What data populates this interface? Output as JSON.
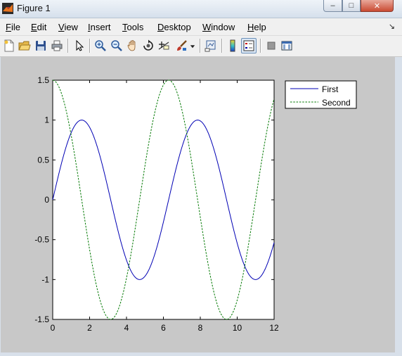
{
  "window": {
    "title": "Figure 1",
    "buttons": {
      "minimize": "–",
      "maximize": "□",
      "close": "✕"
    }
  },
  "menu": {
    "items": [
      {
        "name": "File",
        "key": "F",
        "rest": "ile"
      },
      {
        "name": "Edit",
        "key": "E",
        "rest": "dit"
      },
      {
        "name": "View",
        "key": "V",
        "rest": "iew"
      },
      {
        "name": "Insert",
        "key": "I",
        "rest": "nsert"
      },
      {
        "name": "Tools",
        "key": "T",
        "rest": "ools"
      },
      {
        "name": "Desktop",
        "key": "D",
        "rest": "esktop"
      },
      {
        "name": "Window",
        "key": "W",
        "rest": "indow"
      },
      {
        "name": "Help",
        "key": "H",
        "rest": "elp"
      }
    ],
    "overflow_arrow": "↘"
  },
  "toolbar": {
    "icons": [
      "new-figure-icon",
      "open-file-icon",
      "save-icon",
      "print-icon",
      "edit-plot-icon",
      "zoom-in-icon",
      "zoom-out-icon",
      "pan-icon",
      "rotate-3d-icon",
      "data-cursor-icon",
      "brush-icon",
      "brush-dropdown-icon",
      "link-plot-icon",
      "colorbar-icon",
      "legend-icon",
      "hide-plot-tools-icon",
      "show-plot-tools-icon"
    ]
  },
  "chart_data": {
    "type": "line",
    "title": "",
    "xlabel": "",
    "ylabel": "",
    "xlim": [
      0,
      12
    ],
    "ylim": [
      -1.5,
      1.5
    ],
    "xticks": [
      "0",
      "2",
      "4",
      "6",
      "8",
      "10",
      "12"
    ],
    "yticks": [
      "1.5",
      "1",
      "0.5",
      "0",
      "-0.5",
      "-1",
      "-1.5"
    ],
    "grid": false,
    "legend_position": "outside-top-right",
    "series": [
      {
        "name": "First",
        "function": "sin(x)",
        "color": "#0000b4",
        "style": "solid",
        "x": [
          0,
          1,
          1.571,
          2,
          3,
          4,
          4.712,
          5,
          6,
          7,
          7.854,
          8,
          9,
          10,
          10.996,
          11,
          12
        ],
        "values": [
          0,
          0.841,
          1,
          0.909,
          0.141,
          -0.757,
          -1,
          -0.959,
          -0.279,
          0.657,
          1,
          0.989,
          0.412,
          -0.544,
          -1,
          -1,
          -0.537
        ]
      },
      {
        "name": "Second",
        "function": "1.5*cos(x)",
        "color": "#007800",
        "style": "dashed",
        "x": [
          0,
          1,
          2,
          3,
          3.142,
          4,
          5,
          6,
          6.283,
          7,
          8,
          9,
          9.425,
          10,
          11,
          12
        ],
        "values": [
          1.5,
          0.81,
          -0.624,
          -1.485,
          -1.5,
          -0.98,
          0.425,
          1.44,
          1.5,
          1.131,
          -0.218,
          -1.367,
          -1.5,
          -1.259,
          0.007,
          1.266
        ]
      }
    ]
  }
}
